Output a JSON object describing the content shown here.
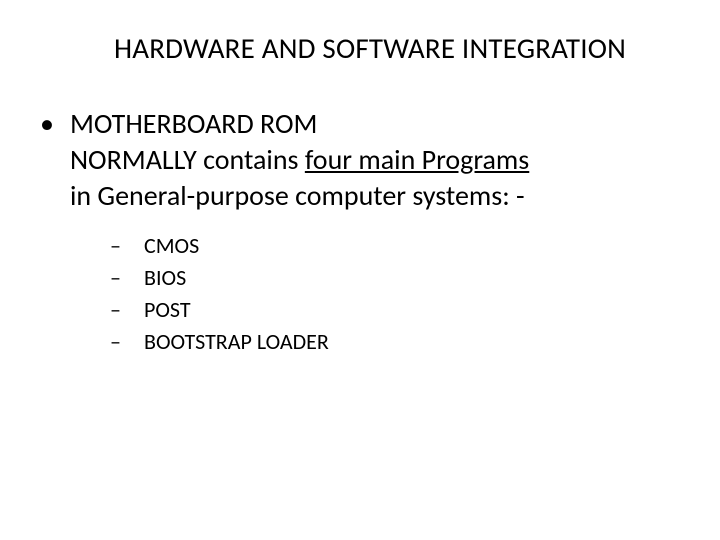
{
  "title": "HARDWARE AND SOFTWARE INTEGRATION",
  "bullet": {
    "line1": "MOTHERBOARD ROM",
    "line2_pre": "NORMALLY contains ",
    "line2_underlined": "four main Programs",
    "line3": "in General-purpose computer systems: -"
  },
  "sub_items": [
    "CMOS",
    "BIOS",
    "POST",
    "BOOTSTRAP LOADER"
  ],
  "marks": {
    "bullet": "•",
    "dash": "–"
  }
}
